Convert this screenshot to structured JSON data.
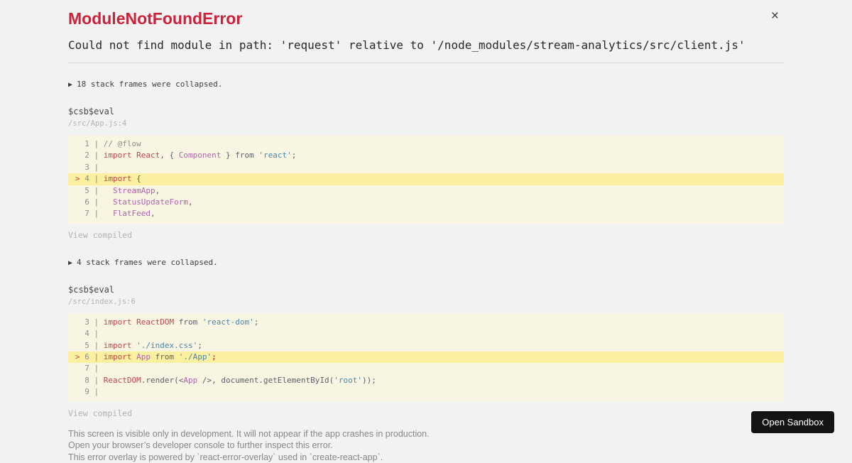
{
  "colors": {
    "page_background": "#f2f2f2",
    "title_red": "#cc2139",
    "keyword_red": "#c7444a",
    "identifier_purple": "#b263ae",
    "string_blue": "#4886ad",
    "code_gray": "#5c6166",
    "code_block_background": "#f9f5e3",
    "highlight_line_background": "#faf0a0",
    "button_background": "#141414",
    "button_text": "#ffffff",
    "footer_gray": "#84888b"
  },
  "header": {
    "title": "ModuleNotFoundError",
    "close_icon": "×",
    "message": "Could not find module in path: 'request' relative to '/node_modules/stream-analytics/src/client.js'"
  },
  "sections": [
    {
      "toggle": {
        "icon": "▶",
        "label": "18 stack frames were collapsed."
      },
      "frame_function": "$csb$eval",
      "frame_location": "/src/App.js:4",
      "view_compiled_label": "View compiled",
      "code_lines": [
        {
          "highlight": false,
          "tokens": [
            {
              "t": "  1 | ",
              "c": "ln"
            },
            {
              "t": "// @flow",
              "c": "com"
            }
          ]
        },
        {
          "highlight": false,
          "tokens": [
            {
              "t": "  2 | ",
              "c": "ln"
            },
            {
              "t": "import",
              "c": "kw"
            },
            {
              "t": " ",
              "c": "pln"
            },
            {
              "t": "React",
              "c": "kw"
            },
            {
              "t": ", { ",
              "c": "pln"
            },
            {
              "t": "Component",
              "c": "id"
            },
            {
              "t": " } from ",
              "c": "pln"
            },
            {
              "t": "'react'",
              "c": "str"
            },
            {
              "t": ";",
              "c": "pln"
            }
          ]
        },
        {
          "highlight": false,
          "tokens": [
            {
              "t": "  3 | ",
              "c": "ln"
            }
          ]
        },
        {
          "highlight": true,
          "tokens": [
            {
              "t": "> ",
              "c": "mk"
            },
            {
              "t": "4 | ",
              "c": "ln"
            },
            {
              "t": "import",
              "c": "kw"
            },
            {
              "t": " {",
              "c": "pln"
            }
          ]
        },
        {
          "highlight": false,
          "tokens": [
            {
              "t": "  5 | ",
              "c": "ln"
            },
            {
              "t": "  ",
              "c": "pln"
            },
            {
              "t": "StreamApp",
              "c": "id"
            },
            {
              "t": ",",
              "c": "pln"
            }
          ]
        },
        {
          "highlight": false,
          "tokens": [
            {
              "t": "  6 | ",
              "c": "ln"
            },
            {
              "t": "  ",
              "c": "pln"
            },
            {
              "t": "StatusUpdateForm",
              "c": "id"
            },
            {
              "t": ",",
              "c": "pln"
            }
          ]
        },
        {
          "highlight": false,
          "tokens": [
            {
              "t": "  7 | ",
              "c": "ln"
            },
            {
              "t": "  ",
              "c": "pln"
            },
            {
              "t": "FlatFeed",
              "c": "id"
            },
            {
              "t": ",",
              "c": "pln"
            }
          ]
        }
      ]
    },
    {
      "toggle": {
        "icon": "▶",
        "label": "4 stack frames were collapsed."
      },
      "frame_function": "$csb$eval",
      "frame_location": "/src/index.js:6",
      "view_compiled_label": "View compiled",
      "code_lines": [
        {
          "highlight": false,
          "tokens": [
            {
              "t": "  3 | ",
              "c": "ln"
            },
            {
              "t": "import",
              "c": "kw"
            },
            {
              "t": " ",
              "c": "pln"
            },
            {
              "t": "ReactDOM",
              "c": "kw"
            },
            {
              "t": " from ",
              "c": "pln"
            },
            {
              "t": "'react-dom'",
              "c": "str"
            },
            {
              "t": ";",
              "c": "pln"
            }
          ]
        },
        {
          "highlight": false,
          "tokens": [
            {
              "t": "  4 | ",
              "c": "ln"
            }
          ]
        },
        {
          "highlight": false,
          "tokens": [
            {
              "t": "  5 | ",
              "c": "ln"
            },
            {
              "t": "import",
              "c": "kw"
            },
            {
              "t": " ",
              "c": "pln"
            },
            {
              "t": "'./index.css'",
              "c": "str"
            },
            {
              "t": ";",
              "c": "pln"
            }
          ]
        },
        {
          "highlight": true,
          "tokens": [
            {
              "t": "> ",
              "c": "mk"
            },
            {
              "t": "6 | ",
              "c": "ln"
            },
            {
              "t": "import",
              "c": "kw"
            },
            {
              "t": " ",
              "c": "pln"
            },
            {
              "t": "App",
              "c": "id"
            },
            {
              "t": " from ",
              "c": "pln"
            },
            {
              "t": "'./App'",
              "c": "str"
            },
            {
              "t": ";",
              "c": "err"
            }
          ]
        },
        {
          "highlight": false,
          "tokens": [
            {
              "t": "  7 | ",
              "c": "ln"
            }
          ]
        },
        {
          "highlight": false,
          "tokens": [
            {
              "t": "  8 | ",
              "c": "ln"
            },
            {
              "t": "ReactDOM",
              "c": "kw"
            },
            {
              "t": ".render(<",
              "c": "pln"
            },
            {
              "t": "App",
              "c": "id"
            },
            {
              "t": " />, document.getElementById(",
              "c": "pln"
            },
            {
              "t": "'root'",
              "c": "str"
            },
            {
              "t": "));",
              "c": "pln"
            }
          ]
        },
        {
          "highlight": false,
          "tokens": [
            {
              "t": "  9 | ",
              "c": "ln"
            }
          ]
        }
      ]
    }
  ],
  "footer": {
    "lines": [
      "This screen is visible only in development. It will not appear if the app crashes in production.",
      "Open your browser’s developer console to further inspect this error.",
      "This error overlay is powered by `react-error-overlay` used in `create-react-app`."
    ]
  },
  "open_sandbox_button": {
    "label": "Open Sandbox"
  }
}
